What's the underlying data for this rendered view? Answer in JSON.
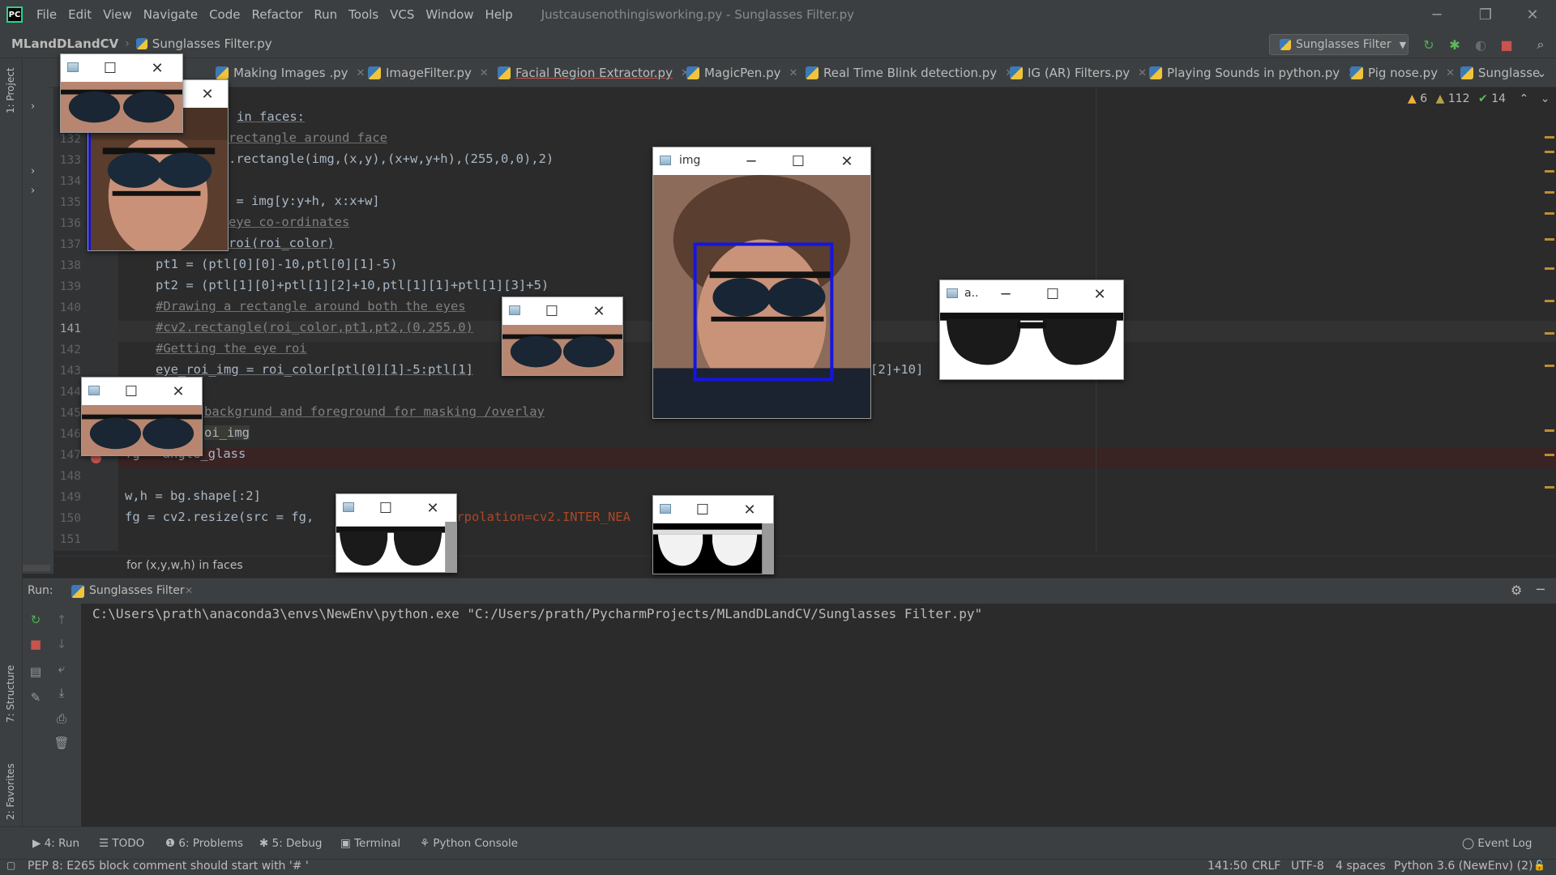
{
  "titlebar": {
    "logo": "PC",
    "menu": [
      "File",
      "Edit",
      "View",
      "Navigate",
      "Code",
      "Refactor",
      "Run",
      "Tools",
      "VCS",
      "Window",
      "Help"
    ],
    "window_title": "Justcausenothingisworking.py - Sunglasses Filter.py",
    "controls": {
      "minimize": "─",
      "restore": "❐",
      "close": "✕"
    }
  },
  "navbar": {
    "project": "MLandDLandCV",
    "file": "Sunglasses Filter.py",
    "run_config": "Sunglasses Filter"
  },
  "tabs": [
    {
      "label": "Making Images .py"
    },
    {
      "label": "ImageFilter.py"
    },
    {
      "label": "Facial Region Extractor.py"
    },
    {
      "label": "MagicPen.py"
    },
    {
      "label": "Real Time Blink detection.py"
    },
    {
      "label": "IG (AR) Filters.py"
    },
    {
      "label": "Playing Sounds in python.py"
    },
    {
      "label": "Pig nose.py"
    },
    {
      "label": "Sunglasse"
    }
  ],
  "inspection": {
    "warnings": "6",
    "weak_warnings": "112",
    "ok": "14"
  },
  "left_strip": {
    "project_label": "1: Project",
    "structure_label": "7: Structure",
    "favorites_label": "2: Favorites"
  },
  "editor": {
    "line_numbers": [
      "132",
      "133",
      "134",
      "135",
      "136",
      "137",
      "138",
      "139",
      "140",
      "141",
      "142",
      "143",
      "144",
      "145",
      "146",
      "147",
      "148",
      "149",
      "150",
      "151"
    ],
    "first_line_fragment": "in faces:",
    "lines": {
      "l132": "rectangle around face",
      "l133": ".rectangle(img,(x,y),(x+w,y+h),(255,0,0),2)",
      "l135": " = img[y:y+h, x:x+w]",
      "l136": "eye co-ordinates",
      "l137": "roi(roi_color)",
      "l138": "pt1 = (ptl[0][0]-10,ptl[0][1]-5)",
      "l139": "pt2 = (ptl[1][0]+ptl[1][2]+10,ptl[1][1]+ptl[1][3]+5)",
      "l140": "#Drawing a rectangle around both the eyes",
      "l141": "#cv2.rectangle(roi_color,pt1,pt2,(0,255,0)",
      "l142": "#Getting the eye roi",
      "l143a": "eye_roi_img = roi_color[ptl[0][1]-5:ptl[1]",
      "l143b": "[2]+10]",
      "l145": "backgrund and foreground for masking /overlay",
      "l146": "oi_img",
      "l147": "fg = angle_glass",
      "l149": "w,h = bg.shape[:2]",
      "l150a": "fg = cv2.resize(src = fg,",
      "l150b": "erpolation=cv2.INTER_NEA"
    },
    "breadcrumb": "for (x,y,w,h) in faces"
  },
  "run": {
    "label": "Run:",
    "tab": "Sunglasses Filter",
    "console": "C:\\Users\\prath\\anaconda3\\envs\\NewEnv\\python.exe \"C:/Users/prath/PycharmProjects/MLandDLandCV/Sunglasses Filter.py\""
  },
  "bottom_tools": [
    {
      "label": "4: Run",
      "icon": "play-icon"
    },
    {
      "label": "TODO",
      "icon": "list-icon"
    },
    {
      "label": "6: Problems",
      "icon": "info-icon"
    },
    {
      "label": "5: Debug",
      "icon": "bug-icon"
    },
    {
      "label": "Terminal",
      "icon": "terminal-icon"
    },
    {
      "label": "Python Console",
      "icon": "python-icon"
    }
  ],
  "event_log": "Event Log",
  "status": {
    "message": "PEP 8: E265 block comment should start with '# '",
    "position": "141:50",
    "line_sep": "CRLF",
    "encoding": "UTF-8",
    "indent": "4 spaces",
    "interpreter": "Python 3.6 (NewEnv) (2)"
  },
  "image_windows": {
    "img_title": "img",
    "glasses_title": "a.."
  }
}
